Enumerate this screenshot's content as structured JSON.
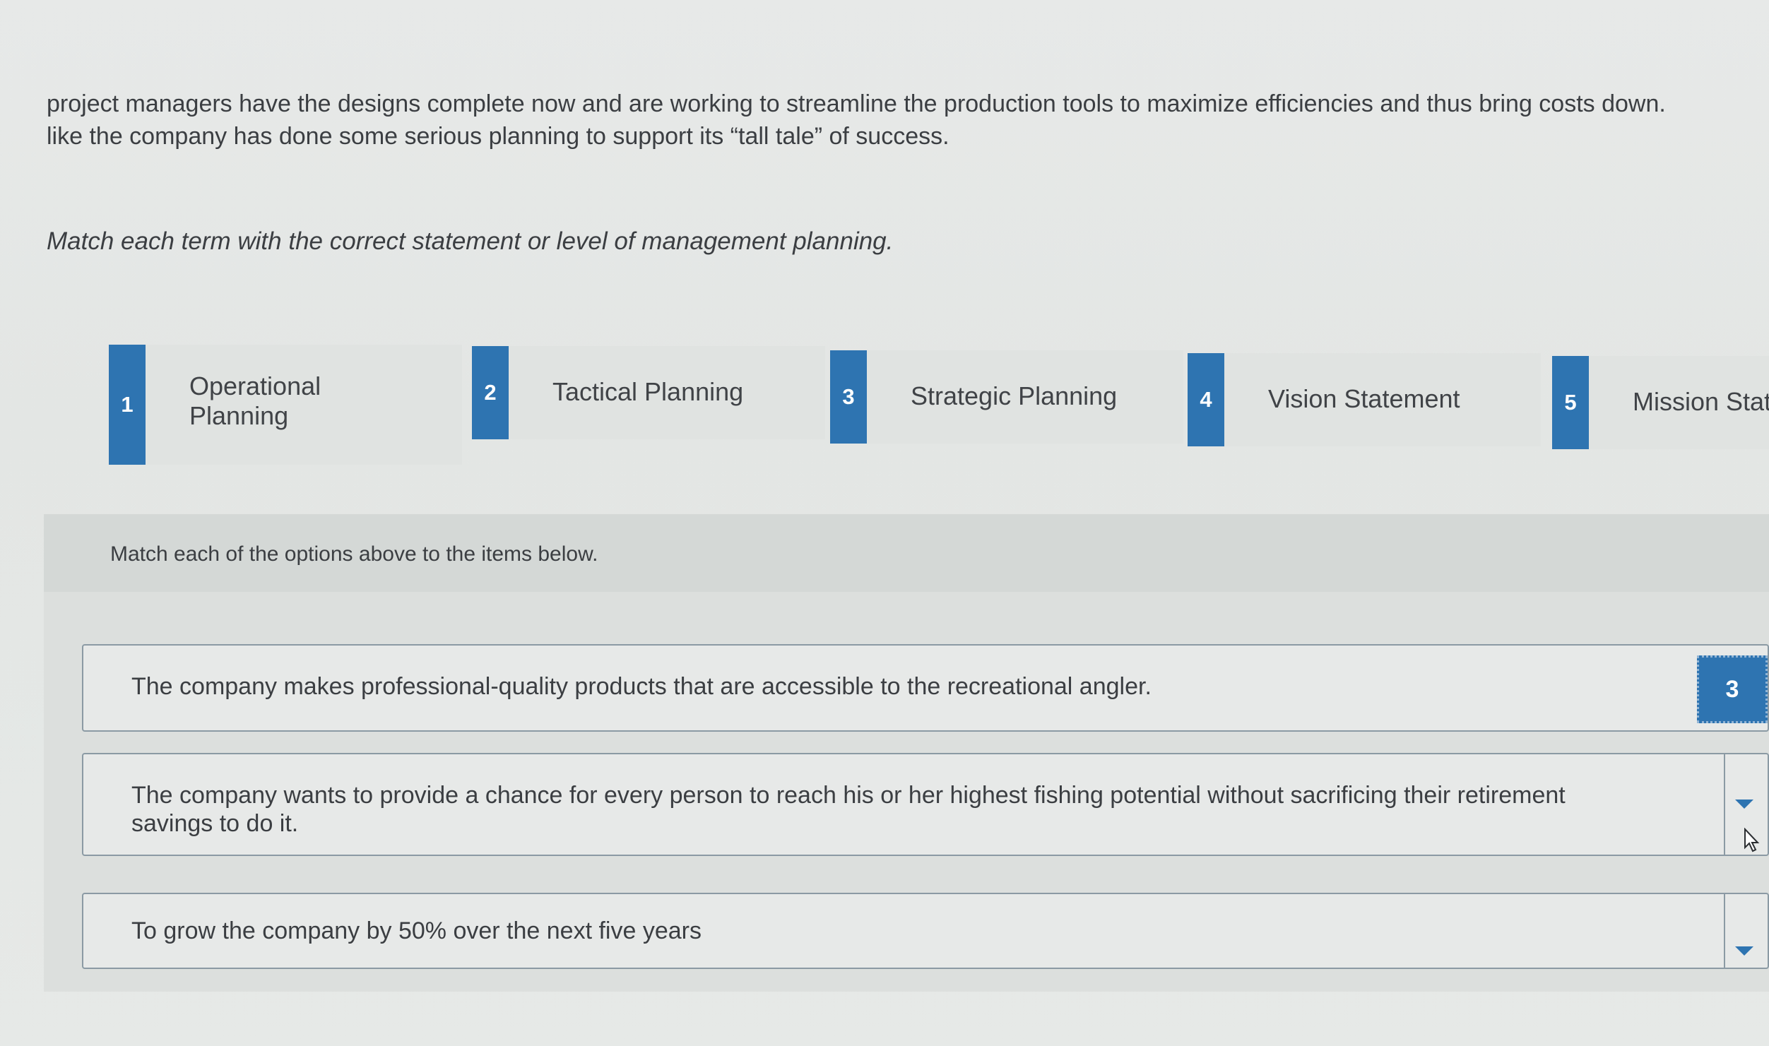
{
  "passage": {
    "line1": "project managers have the designs complete now and are working to streamline the production tools to maximize efficiencies and thus bring costs down.",
    "line2": "like the company has done some serious planning to support its “tall tale” of success."
  },
  "prompt": "Match each term with the correct statement or level of management planning.",
  "terms": [
    {
      "number": "1",
      "label": "Operational Planning"
    },
    {
      "number": "2",
      "label": "Tactical Planning"
    },
    {
      "number": "3",
      "label": "Strategic Planning"
    },
    {
      "number": "4",
      "label": "Vision Statement"
    },
    {
      "number": "5",
      "label": "Mission Stat"
    }
  ],
  "instructions": "Match each of the options above to the items below.",
  "items": [
    {
      "text": "The company makes professional-quality products that are accessible to the recreational angler.",
      "selected": "3"
    },
    {
      "text": "The company wants to provide a chance for every person to reach his or her highest fishing potential without sacrificing their retirement savings to do it.",
      "selected": ""
    },
    {
      "text": "To grow the company by 50% over the next five years",
      "selected": ""
    }
  ],
  "colors": {
    "accent": "#2e74b1",
    "border": "#8b9aa4",
    "background": "#e6e9e7"
  },
  "icons": {
    "dropdown": "caret-down-icon",
    "cursor": "mouse-pointer-icon"
  }
}
